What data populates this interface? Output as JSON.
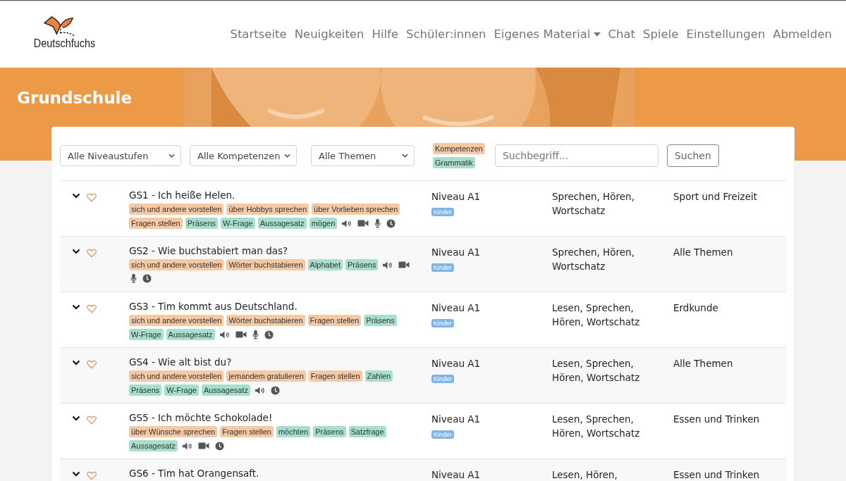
{
  "site": {
    "logo_text": "Deutschfuchs",
    "nav": [
      {
        "label": "Startseite",
        "has_menu": false
      },
      {
        "label": "Neuigkeiten",
        "has_menu": false
      },
      {
        "label": "Hilfe",
        "has_menu": false
      },
      {
        "label": "Schüler:innen",
        "has_menu": false
      },
      {
        "label": "Eigenes Material",
        "has_menu": true
      },
      {
        "label": "Chat",
        "has_menu": false
      },
      {
        "label": "Spiele",
        "has_menu": false
      },
      {
        "label": "Einstellungen",
        "has_menu": false
      },
      {
        "label": "Abmelden",
        "has_menu": false
      }
    ]
  },
  "banner": {
    "title": "Grundschule"
  },
  "filters": {
    "dropdowns": [
      "Alle Niveaustufen",
      "Alle Kompetenzen",
      "Alle Themen"
    ],
    "legend": [
      {
        "label": "Kompetenzen",
        "kind": "kompetenz"
      },
      {
        "label": "Grammatik",
        "kind": "grammatik"
      }
    ],
    "search": {
      "placeholder": "Suchbegriff..."
    },
    "button": "Suchen"
  },
  "rows": [
    {
      "title": "GS1 - Ich heiße Helen.",
      "tags": [
        {
          "label": "sich und andere vorstellen",
          "kind": "kompetenz"
        },
        {
          "label": "über Hobbys sprechen",
          "kind": "kompetenz"
        },
        {
          "label": "über Vorlieben sprechen",
          "kind": "kompetenz"
        },
        {
          "label": "Fragen stellen",
          "kind": "kompetenz"
        },
        {
          "label": "Präsens",
          "kind": "grammatik"
        },
        {
          "label": "W-Frage",
          "kind": "grammatik"
        },
        {
          "label": "Aussagesatz",
          "kind": "grammatik"
        },
        {
          "label": "mögen",
          "kind": "grammatik"
        }
      ],
      "media": [
        {
          "kind": "audio"
        },
        {
          "kind": "video"
        },
        {
          "kind": "mic"
        },
        {
          "kind": "clock"
        }
      ],
      "niveau": "Niveau A1",
      "audience": "Kinder",
      "skills": "Sprechen, Hören, Wortschatz",
      "theme": "Sport und Freizeit"
    },
    {
      "title": "GS2 - Wie buchstabiert man das?",
      "tags": [
        {
          "label": "sich und andere vorstellen",
          "kind": "kompetenz"
        },
        {
          "label": "Wörter buchstabieren",
          "kind": "kompetenz"
        },
        {
          "label": "Alphabet",
          "kind": "grammatik"
        },
        {
          "label": "Präsens",
          "kind": "grammatik"
        }
      ],
      "media": [
        {
          "kind": "audio"
        },
        {
          "kind": "video"
        },
        {
          "kind": "mic"
        },
        {
          "kind": "clock"
        }
      ],
      "niveau": "Niveau A1",
      "audience": "Kinder",
      "skills": "Sprechen, Hören, Wortschatz",
      "theme": "Alle Themen"
    },
    {
      "title": "GS3 - Tim kommt aus Deutschland.",
      "tags": [
        {
          "label": "sich und andere vorstellen",
          "kind": "kompetenz"
        },
        {
          "label": "Wörter buchstabieren",
          "kind": "kompetenz"
        },
        {
          "label": "Fragen stellen",
          "kind": "kompetenz"
        },
        {
          "label": "Präsens",
          "kind": "grammatik"
        },
        {
          "label": "W-Frage",
          "kind": "grammatik"
        },
        {
          "label": "Aussagesatz",
          "kind": "grammatik"
        }
      ],
      "media": [
        {
          "kind": "audio"
        },
        {
          "kind": "video"
        },
        {
          "kind": "mic"
        },
        {
          "kind": "clock"
        }
      ],
      "niveau": "Niveau A1",
      "audience": "Kinder",
      "skills": "Lesen, Sprechen, Hören, Wortschatz",
      "theme": "Erdkunde"
    },
    {
      "title": "GS4 - Wie alt bist du?",
      "tags": [
        {
          "label": "sich und andere vorstellen",
          "kind": "kompetenz"
        },
        {
          "label": "jemandem gratulieren",
          "kind": "kompetenz"
        },
        {
          "label": "Fragen stellen",
          "kind": "kompetenz"
        },
        {
          "label": "Zahlen",
          "kind": "grammatik"
        },
        {
          "label": "Präsens",
          "kind": "grammatik"
        },
        {
          "label": "W-Frage",
          "kind": "grammatik"
        },
        {
          "label": "Aussagesatz",
          "kind": "grammatik"
        }
      ],
      "media": [
        {
          "kind": "audio"
        },
        {
          "kind": "clock"
        }
      ],
      "niveau": "Niveau A1",
      "audience": "Kinder",
      "skills": "Lesen, Sprechen, Hören, Wortschatz",
      "theme": "Alle Themen"
    },
    {
      "title": "GS5 - Ich möchte Schokolade!",
      "tags": [
        {
          "label": "über Wünsche sprechen",
          "kind": "kompetenz"
        },
        {
          "label": "Fragen stellen",
          "kind": "kompetenz"
        },
        {
          "label": "möchten",
          "kind": "grammatik"
        },
        {
          "label": "Präsens",
          "kind": "grammatik"
        },
        {
          "label": "Satzfrage",
          "kind": "grammatik"
        },
        {
          "label": "Aussagesatz",
          "kind": "grammatik"
        }
      ],
      "media": [
        {
          "kind": "audio"
        },
        {
          "kind": "video"
        },
        {
          "kind": "clock"
        }
      ],
      "niveau": "Niveau A1",
      "audience": "Kinder",
      "skills": "Lesen, Sprechen, Hören, Wortschatz",
      "theme": "Essen und Trinken"
    },
    {
      "title": "GS6 - Tim hat Orangensaft.",
      "niveau": "Niveau A1",
      "skills": "Lesen, Hören,",
      "theme": "Essen und Trinken"
    }
  ]
}
